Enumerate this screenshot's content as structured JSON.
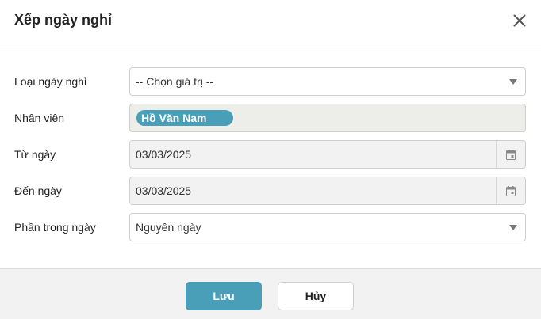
{
  "dialog": {
    "title": "Xếp ngày nghỉ",
    "close_icon": "close-icon"
  },
  "form": {
    "leave_type": {
      "label": "Loại ngày nghỉ",
      "value": "-- Chọn giá trị --"
    },
    "employee": {
      "label": "Nhân viên",
      "tags": [
        "Hồ Văn Nam"
      ]
    },
    "from_date": {
      "label": "Từ ngày",
      "value": "03/03/2025",
      "icon": "calendar-icon"
    },
    "to_date": {
      "label": "Đến ngày",
      "value": "03/03/2025",
      "icon": "calendar-icon"
    },
    "day_part": {
      "label": "Phần trong ngày",
      "value": "Nguyên ngày"
    }
  },
  "footer": {
    "save_label": "Lưu",
    "cancel_label": "Hủy"
  },
  "colors": {
    "accent": "#4a9fb8",
    "footer_bg": "#f2f2f2"
  }
}
